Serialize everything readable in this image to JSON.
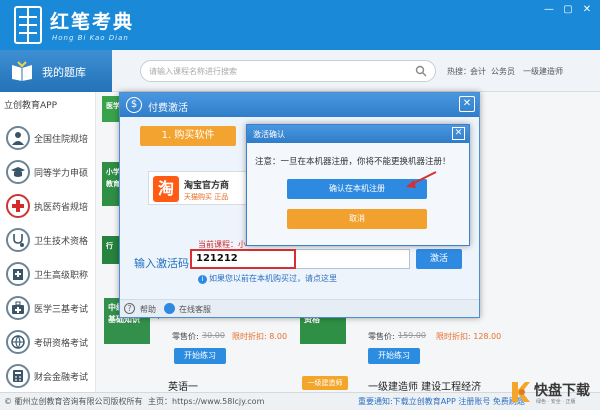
{
  "app": {
    "title": "红笔考典",
    "subtitle": "Hong Bi Kao Dian"
  },
  "window_controls": [
    "—",
    "▢",
    "✕"
  ],
  "topbar": {
    "my_bank_label": "我的题库",
    "search_placeholder": "请输入课程名称进行搜索",
    "hot_label": "热搜：",
    "hot_items": [
      "会计",
      "公务员",
      "一级建造师"
    ]
  },
  "sidebar": {
    "header": "立创教育APP",
    "items": [
      {
        "label": "全国住院规培",
        "icon": "doctor-icon"
      },
      {
        "label": "同等学力申硕",
        "icon": "graduation-cap-icon"
      },
      {
        "label": "执医药省规培",
        "icon": "medical-cross-icon"
      },
      {
        "label": "卫生技术资格",
        "icon": "stethoscope-icon"
      },
      {
        "label": "卫生高级职称",
        "icon": "hospital-icon"
      },
      {
        "label": "医学三基考试",
        "icon": "medkit-icon"
      },
      {
        "label": "考研资格考试",
        "icon": "globe-icon"
      },
      {
        "label": "财会金融考试",
        "icon": "calculator-icon"
      }
    ]
  },
  "content": {
    "card_labels": [
      "医学",
      "小学教育",
      "行",
      "中级经济基础知识",
      "护士执业资格"
    ],
    "card_fragment": "中",
    "price_label": "零售价:",
    "price_old_1": "30.00",
    "price_sale_1": "限时折扣: 8.00",
    "price_old_2": "159.00",
    "price_sale_2": "限时折扣: 128.00",
    "practice_button": "开始练习",
    "course_left": "英语一",
    "course_right": "一级建造师 建设工程经济",
    "badge": "一级建造师"
  },
  "pay_dialog": {
    "title": "付费激活",
    "step_tab": "1. 购买软件",
    "taobao_name": "淘宝官方商",
    "taobao_sub": "天猫购买  正品",
    "current_course": "当前课程：小",
    "code_label": "输入激活码:",
    "code_value": "121212",
    "activate_button": "激活",
    "paid_hint": "如果您以前在本机购买过，请点这里",
    "help_label": "帮助",
    "support_label": "在线客服",
    "close_glyph": "✕",
    "dollar_glyph": "$",
    "question_glyph": "?",
    "info_glyph": "i",
    "taobao_glyph": "淘"
  },
  "confirm_dialog": {
    "title": "激活确认",
    "message": "注意：一旦在本机器注册，你将不能更换机器注册！",
    "confirm_button": "确认在本机注册",
    "cancel_button": "取消",
    "close_glyph": "✕"
  },
  "footer": {
    "copyright": "© 衢州立创教育咨询有限公司版权所有",
    "homepage": "主页：https://www.58lcjy.com",
    "notice": "重要通知:下载立创教育APP 注册账号 免费刷题"
  },
  "watermark": {
    "brand": "快盘下载",
    "sub": "绿色 · 安全 · 正版"
  },
  "colors": {
    "primary": "#1a8ad8",
    "accent_orange": "#f3a32f",
    "alert_red": "#d83030",
    "card_green": "#3aa24b"
  }
}
